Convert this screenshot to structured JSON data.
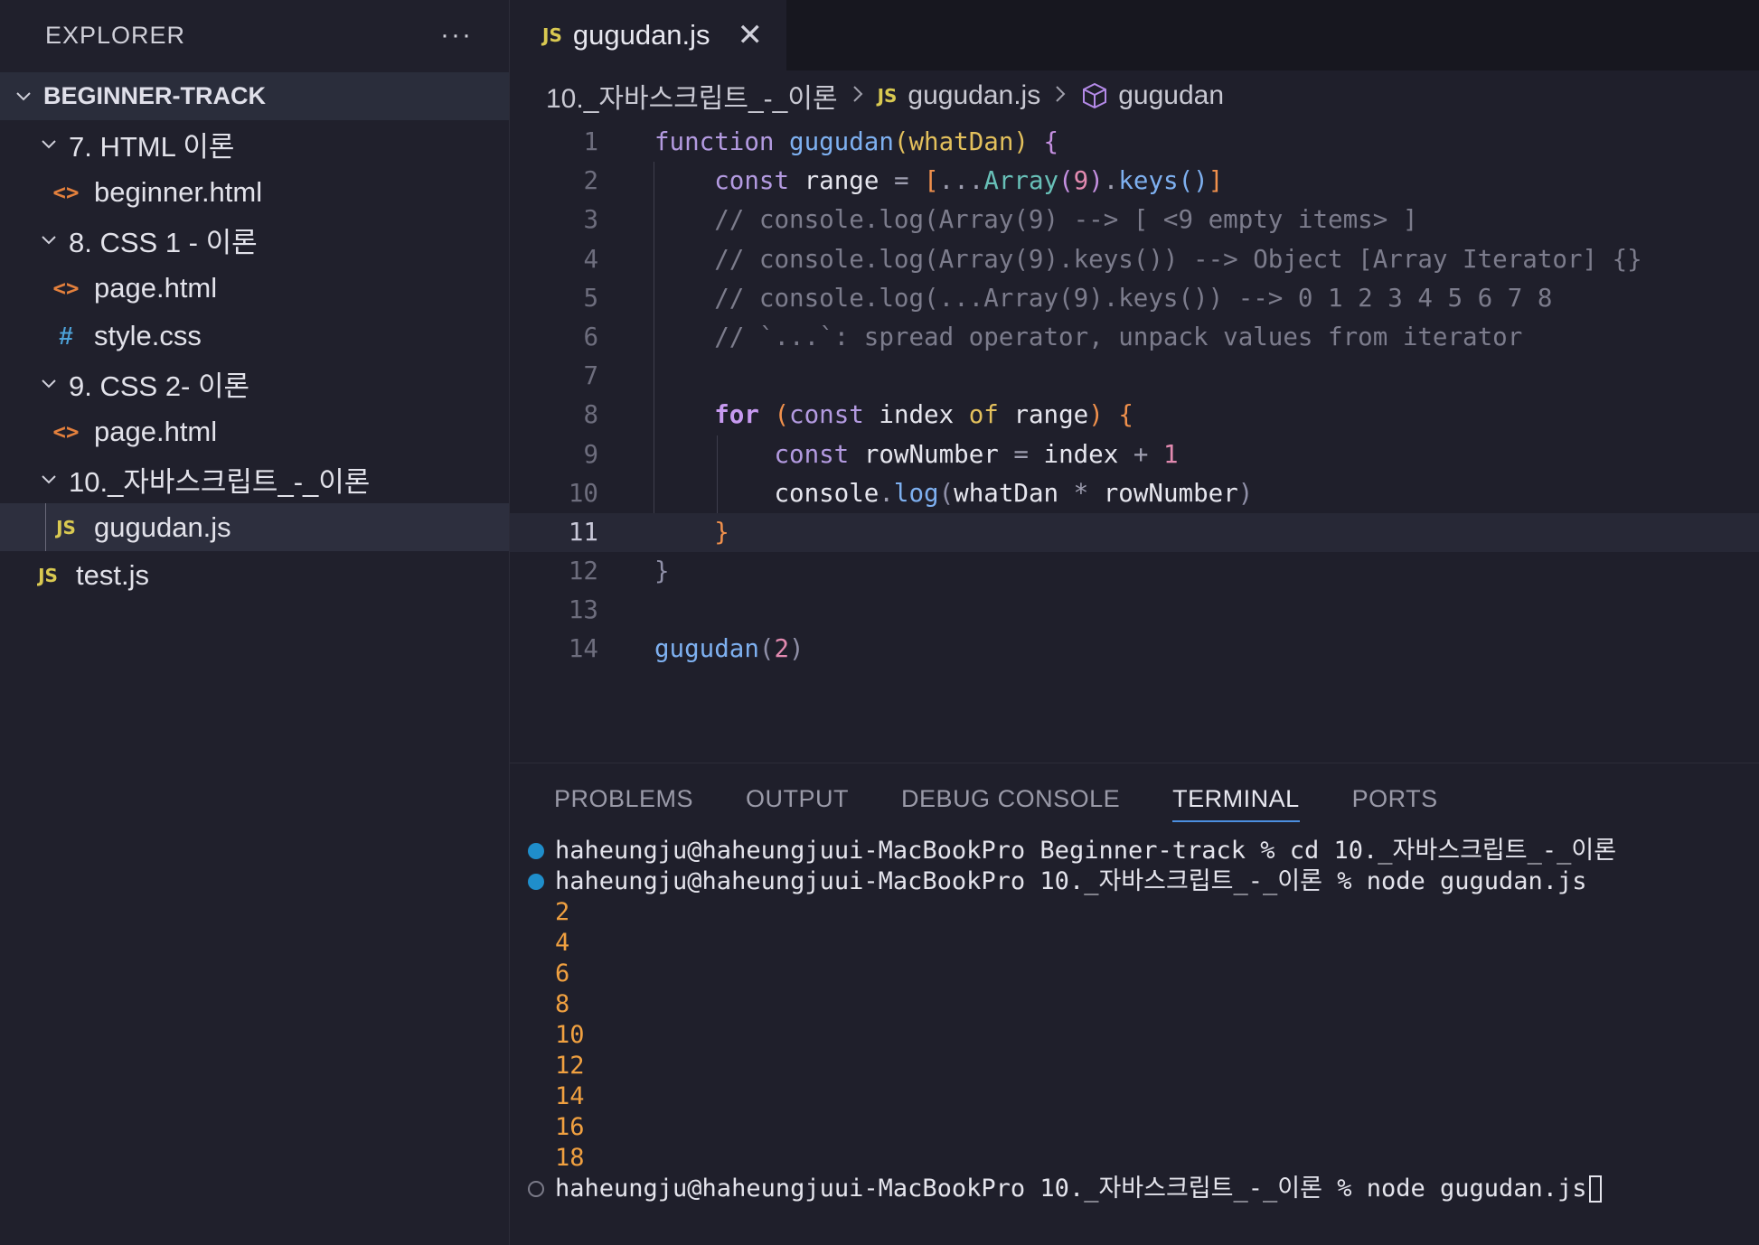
{
  "sidebar": {
    "title": "EXPLORER",
    "more": "···",
    "root": "BEGINNER-TRACK",
    "items": [
      {
        "type": "folder",
        "label": "7. HTML 이론"
      },
      {
        "type": "html",
        "label": "beginner.html"
      },
      {
        "type": "folder",
        "label": "8. CSS 1 - 이론"
      },
      {
        "type": "html",
        "label": "page.html"
      },
      {
        "type": "css",
        "label": "style.css"
      },
      {
        "type": "folder",
        "label": "9. CSS 2- 이론"
      },
      {
        "type": "html",
        "label": "page.html"
      },
      {
        "type": "folder",
        "label": "10._자바스크립트_-_이론"
      },
      {
        "type": "js",
        "label": "gugudan.js"
      },
      {
        "type": "js",
        "label": "test.js"
      }
    ]
  },
  "icons": {
    "js": "JS",
    "html": "<>",
    "css": "#"
  },
  "tab": {
    "label": "gugudan.js",
    "close": "✕"
  },
  "breadcrumb": {
    "folder": "10._자바스크립트_-_이론",
    "file": "gugudan.js",
    "symbol": "gugudan"
  },
  "editor": {
    "line_numbers": [
      "1",
      "2",
      "3",
      "4",
      "5",
      "6",
      "7",
      "8",
      "9",
      "10",
      "11",
      "12",
      "13",
      "14"
    ],
    "lines": [
      "function gugudan(whatDan) {",
      "    const range = [...Array(9).keys()]",
      "    // console.log(Array(9) --> [ <9 empty items> ]",
      "    // console.log(Array(9).keys()) --> Object [Array Iterator] {}",
      "    // console.log(...Array(9).keys()) --> 0 1 2 3 4 5 6 7 8",
      "    // `...`: spread operator, unpack values from iterator",
      "",
      "    for (const index of range) {",
      "        const rowNumber = index + 1",
      "        console.log(whatDan * rowNumber)",
      "    }",
      "}",
      "",
      "gugudan(2)"
    ]
  },
  "panel": {
    "tabs": [
      "PROBLEMS",
      "OUTPUT",
      "DEBUG CONSOLE",
      "TERMINAL",
      "PORTS"
    ],
    "active_tab": "TERMINAL"
  },
  "terminal": {
    "commands": [
      "haheungju@haheungjuui-MacBookPro Beginner-track % cd 10._자바스크립트_-_이론",
      "haheungju@haheungjuui-MacBookPro 10._자바스크립트_-_이론 % node gugudan.js"
    ],
    "output": [
      "2",
      "4",
      "6",
      "8",
      "10",
      "12",
      "14",
      "16",
      "18"
    ],
    "prompt": "haheungju@haheungjuui-MacBookPro 10._자바스크립트_-_이론 % node gugudan.js"
  },
  "colors": {
    "accent": "#4c8fe0",
    "js": "#d9c951",
    "html": "#e3803d",
    "css": "#4da2d8",
    "output": "#f0a040"
  }
}
